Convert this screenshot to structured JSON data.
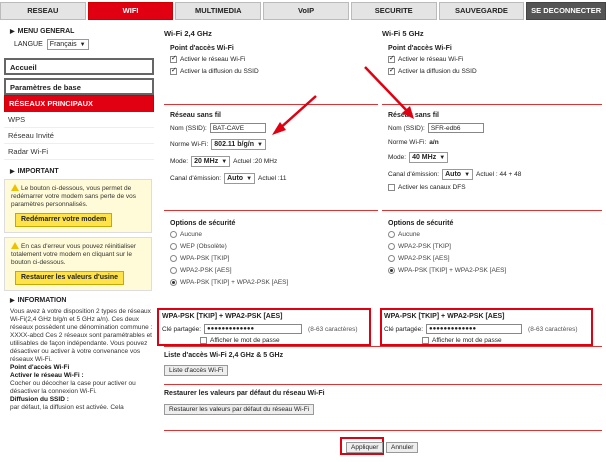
{
  "nav": {
    "tabs": [
      "RESEAU",
      "WIFI",
      "MULTIMEDIA",
      "VoIP",
      "SECURITE",
      "SAUVEGARDE"
    ],
    "logout": "SE DECONNECTER"
  },
  "sidebar": {
    "menu_general": "MENU GENERAL",
    "langue_label": "LANGUE",
    "langue_value": "Français",
    "items": [
      "Accueil",
      "Paramètres de base",
      "RÉSEAUX PRINCIPAUX",
      "WPS",
      "Réseau Invité",
      "Radar Wi-Fi"
    ],
    "important": "IMPORTANT",
    "warn1": "Le bouton ci-dessous, vous permet de redémarrer votre modem sans perte de vos paramètres personnalisés.",
    "btn_restart": "Redémarrer votre modem",
    "warn2": "En cas d'erreur vous pouvez réinitialiser totalement votre modem en cliquant sur le bouton ci-dessous.",
    "btn_reset": "Restaurer les valeurs d'usine",
    "information": "INFORMATION",
    "info_intro": "Vous avez à votre disposition 2 types de réseaux Wi-Fi(2,4 GHz b/g/n et 5 GHz a/n). Ces deux réseaux possèdent une dénomination commune : XXXX-abcd Ces 2 réseaux sont paramétrables et utilisables de façon indépendante. Vous pouvez désactiver ou activer à votre convenance vos réseaux Wi-Fi.",
    "info_h1": "Point d'accès Wi-Fi",
    "info_h2": "Activer le réseau Wi-Fi :",
    "info_t2": "Cocher ou décocher la case pour activer ou désactiver la connexion Wi-Fi.",
    "info_h3": "Diffusion du SSID :",
    "info_t3": "par défaut, la diffusion est activée. Cela"
  },
  "wifi24": {
    "title": "Wi-Fi 2,4 GHz",
    "ap_title": "Point d'accès Wi-Fi",
    "activate": "Activer le réseau Wi-Fi",
    "ssid_bcast": "Activer la diffusion du SSID",
    "net_title": "Réseau sans fil",
    "ssid_label": "Nom (SSID):",
    "ssid": "BAT-CAVE",
    "norm_label": "Norme Wi-Fi:",
    "norm": "802.11 b/g/n",
    "mode_label": "Mode:",
    "mode": "20 MHz",
    "mode_actual": "Actuel :20 MHz",
    "chan_label": "Canal d'émission:",
    "chan": "Auto",
    "chan_actual": "Actuel :11",
    "sec_title": "Options de sécurité",
    "sec_options": [
      "Aucune",
      "WEP (Obsolète)",
      "WPA-PSK [TKIP]",
      "WPA2-PSK [AES]",
      "WPA-PSK [TKIP] + WPA2-PSK [AES]"
    ],
    "key_title": "WPA-PSK [TKIP] + WPA2-PSK [AES]",
    "key_label": "Clé partagée:",
    "key": "●●●●●●●●●●●●●",
    "key_hint": "(8-63 caractères)",
    "show_pw": "Afficher le mot de passe"
  },
  "wifi5": {
    "title": "Wi-Fi 5 GHz",
    "ap_title": "Point d'accès Wi-Fi",
    "activate": "Activer le réseau Wi-Fi",
    "ssid_bcast": "Activer la diffusion du SSID",
    "net_title": "Réseau sans fil",
    "ssid_label": "Nom (SSID):",
    "ssid": "SFR-edb6",
    "norm_label": "Norme Wi-Fi:",
    "norm": "a/n",
    "mode_label": "Mode:",
    "mode": "40 MHz",
    "chan_label": "Canal d'émission:",
    "chan": "Auto",
    "chan_actual": "Actuel : 44 + 48",
    "dfs": "Activer les canaux DFS",
    "sec_title": "Options de sécurité",
    "sec_options": [
      "Aucune",
      "WPA2-PSK [TKIP]",
      "WPA2-PSK [AES]",
      "WPA-PSK [TKIP] + WPA2-PSK [AES]"
    ],
    "key_title": "WPA-PSK [TKIP] + WPA2-PSK [AES]",
    "key_label": "Clé partagée:",
    "key": "●●●●●●●●●●●●●",
    "key_hint": "(8-63 caractères)",
    "show_pw": "Afficher le mot de passe"
  },
  "access_list": {
    "title": "Liste d'accès Wi-Fi 2,4 GHz & 5 GHz",
    "btn": "Liste d'accès Wi-Fi"
  },
  "restore": {
    "title": "Restaurer les valeurs par défaut du réseau Wi-Fi",
    "btn": "Restaurer les valeurs par défaut du réseau Wi-Fi"
  },
  "actions": {
    "apply": "Appliquer",
    "cancel": "Annuler"
  }
}
